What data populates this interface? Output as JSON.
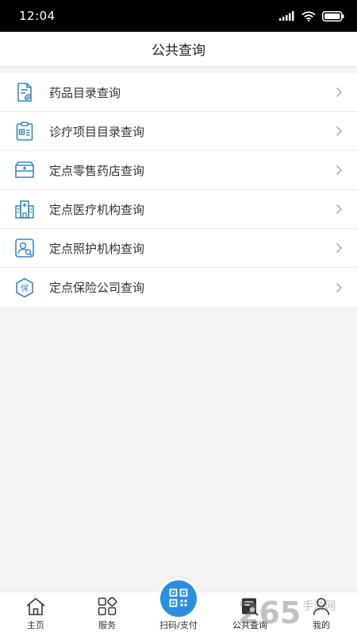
{
  "status_bar": {
    "time": "12:04"
  },
  "nav": {
    "title": "公共查询"
  },
  "menu": {
    "items": [
      {
        "label": "药品目录查询",
        "icon": "drug-list-icon"
      },
      {
        "label": "诊疗项目目录查询",
        "icon": "clipboard-medical-icon"
      },
      {
        "label": "定点零售药店查询",
        "icon": "medicine-box-icon"
      },
      {
        "label": "定点医疗机构查询",
        "icon": "hospital-building-icon"
      },
      {
        "label": "定点照护机构查询",
        "icon": "person-search-icon"
      },
      {
        "label": "定点保险公司查询",
        "icon": "insurance-shield-icon"
      }
    ]
  },
  "tabs": [
    {
      "label": "主页",
      "icon": "home-icon"
    },
    {
      "label": "服务",
      "icon": "grid-icon"
    },
    {
      "label": "扫码/支付",
      "icon": "qr-code-icon"
    },
    {
      "label": "公共查询",
      "icon": "search-list-icon"
    },
    {
      "label": "我的",
      "icon": "user-icon"
    }
  ],
  "watermark": {
    "number": "265",
    "side_text": "手游网"
  },
  "colors": {
    "accent": "#2a8fe0",
    "icon_blue": "#3a86c8",
    "background": "#f4f4f4"
  }
}
